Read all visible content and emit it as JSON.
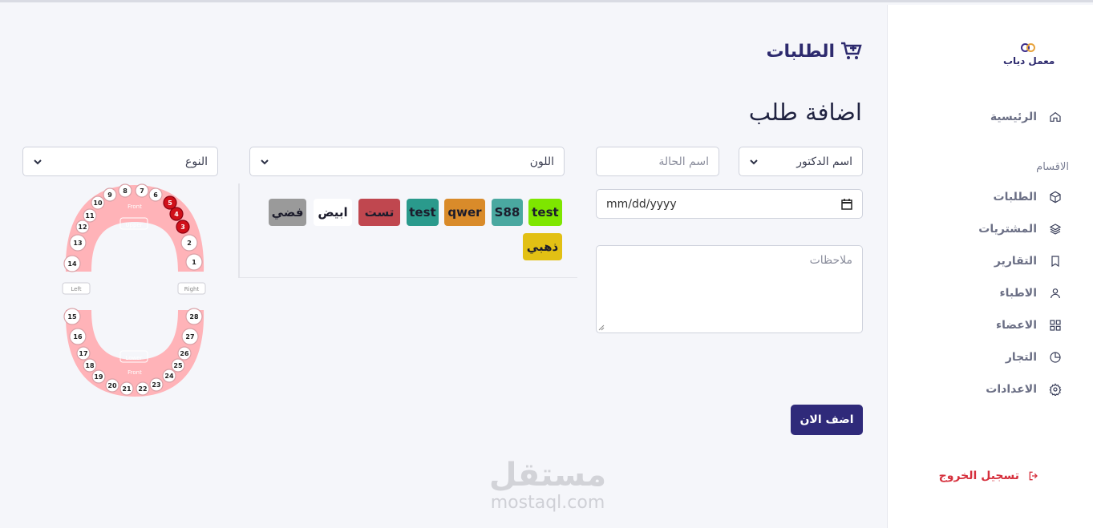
{
  "brand": {
    "name": "معمل دياب"
  },
  "nav": {
    "home": "الرئيسية",
    "section_label": "الاقسام",
    "items": [
      "الطلبات",
      "المشتريات",
      "التقارير",
      "الاطباء",
      "الاعضاء",
      "التجار",
      "الاعدادات"
    ],
    "icons": [
      "cube-icon",
      "layers-icon",
      "bookmark-icon",
      "user-icon",
      "grid-icon",
      "pie-chart-icon",
      "gear-icon"
    ],
    "logout": "تسجيل الخروج"
  },
  "header": {
    "title": "الطلبات"
  },
  "form": {
    "title": "اضافة طلب",
    "doctor_select": "اسم الدكتور",
    "case_name_placeholder": "اسم الحالة",
    "date_value": "mm/dd/yyyy",
    "notes_placeholder": "ملاحظات",
    "color_select": "اللون",
    "type_select": "النوع",
    "submit_label": "اضف الان"
  },
  "colors": [
    {
      "label": "test",
      "bg": "#7ee600"
    },
    {
      "label": "S88",
      "bg": "#4aa8a0"
    },
    {
      "label": "qwer",
      "bg": "#d98b2a"
    },
    {
      "label": "test",
      "bg": "#2a9a8c"
    },
    {
      "label": "تست",
      "bg": "#c0474f"
    },
    {
      "label": "ابيض",
      "bg": "#ffffff"
    },
    {
      "label": "فضي",
      "bg": "#9a9a9a"
    },
    {
      "label": "ذهبي",
      "bg": "#e2c014"
    }
  ],
  "teeth_chart": {
    "upper_label": "Upper",
    "lower_label": "Lower",
    "front_label": "Front",
    "left_label": "Left",
    "right_label": "Right",
    "upper": [
      1,
      2,
      3,
      4,
      5,
      6,
      7,
      8,
      9,
      10,
      11,
      12,
      13,
      14
    ],
    "lower": [
      15,
      16,
      17,
      18,
      19,
      20,
      21,
      22,
      23,
      24,
      25,
      26,
      27,
      28
    ],
    "selected": [
      3,
      4,
      5
    ],
    "selected_color": "#d0101a",
    "gum_color": "#ffb3b8"
  },
  "watermark": {
    "arabic": "مستقل",
    "url": "mostaql.com"
  }
}
